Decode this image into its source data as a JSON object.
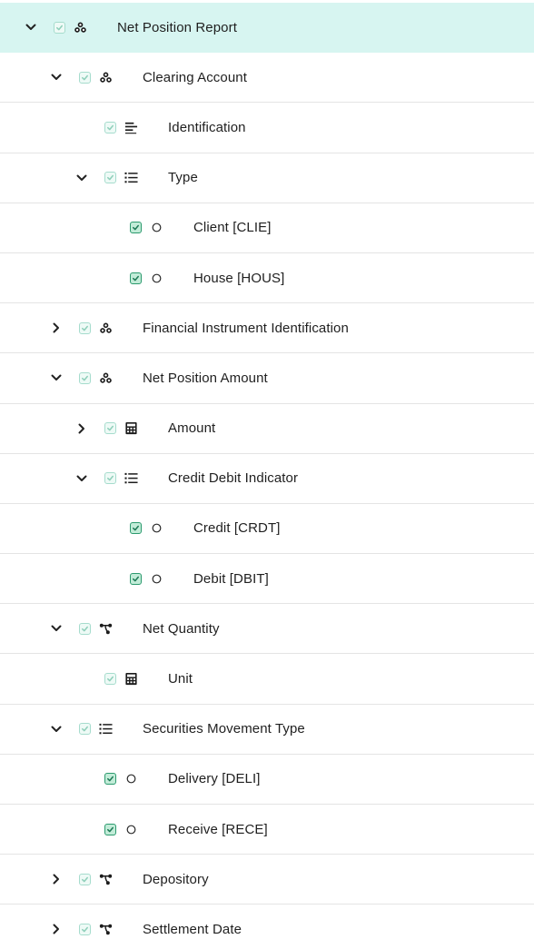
{
  "tree": [
    {
      "label": "Net Position Report",
      "level": 0,
      "expander": "expanded",
      "icon": "group-icon",
      "checkbox": "light",
      "selected": true
    },
    {
      "label": "Clearing Account",
      "level": 1,
      "expander": "expanded",
      "icon": "group-icon",
      "checkbox": "light"
    },
    {
      "label": "Identification",
      "level": 2,
      "expander": "none",
      "icon": "text-lines-icon",
      "checkbox": "light"
    },
    {
      "label": "Type",
      "level": 2,
      "expander": "expanded",
      "icon": "list-icon",
      "checkbox": "light"
    },
    {
      "label": "Client [CLIE]",
      "level": 3,
      "expander": "none",
      "icon": "circle-icon",
      "checkbox": "strong"
    },
    {
      "label": "House [HOUS]",
      "level": 3,
      "expander": "none",
      "icon": "circle-icon",
      "checkbox": "strong"
    },
    {
      "label": "Financial Instrument Identification",
      "level": 1,
      "expander": "collapsed",
      "icon": "group-icon",
      "checkbox": "light"
    },
    {
      "label": "Net Position Amount",
      "level": 1,
      "expander": "expanded",
      "icon": "group-icon",
      "checkbox": "light"
    },
    {
      "label": "Amount",
      "level": 2,
      "expander": "collapsed",
      "icon": "calculator-icon",
      "checkbox": "light"
    },
    {
      "label": "Credit Debit Indicator",
      "level": 2,
      "expander": "expanded",
      "icon": "list-icon",
      "checkbox": "light"
    },
    {
      "label": "Credit [CRDT]",
      "level": 3,
      "expander": "none",
      "icon": "circle-icon",
      "checkbox": "strong"
    },
    {
      "label": "Debit [DBIT]",
      "level": 3,
      "expander": "none",
      "icon": "circle-icon",
      "checkbox": "strong"
    },
    {
      "label": "Net Quantity",
      "level": 1,
      "expander": "expanded",
      "icon": "branch-icon",
      "checkbox": "light"
    },
    {
      "label": "Unit",
      "level": 2,
      "expander": "none",
      "icon": "calculator-icon",
      "checkbox": "light"
    },
    {
      "label": "Securities Movement Type",
      "level": 1,
      "expander": "expanded",
      "icon": "list-icon",
      "checkbox": "light"
    },
    {
      "label": "Delivery [DELI]",
      "level": 2,
      "expander": "none",
      "icon": "circle-icon",
      "checkbox": "strong"
    },
    {
      "label": "Receive [RECE]",
      "level": 2,
      "expander": "none",
      "icon": "circle-icon",
      "checkbox": "strong"
    },
    {
      "label": "Depository",
      "level": 1,
      "expander": "collapsed",
      "icon": "branch-icon",
      "checkbox": "light"
    },
    {
      "label": "Settlement Date",
      "level": 1,
      "expander": "collapsed",
      "icon": "branch-icon",
      "checkbox": "light"
    }
  ],
  "colors": {
    "selected_row": "#d7f5f1",
    "checkbox_light_border": "#a6dccd",
    "checkbox_strong_border": "#2c9a6e",
    "check_mark": "#1e7a56",
    "divider": "#e4e4e4"
  }
}
